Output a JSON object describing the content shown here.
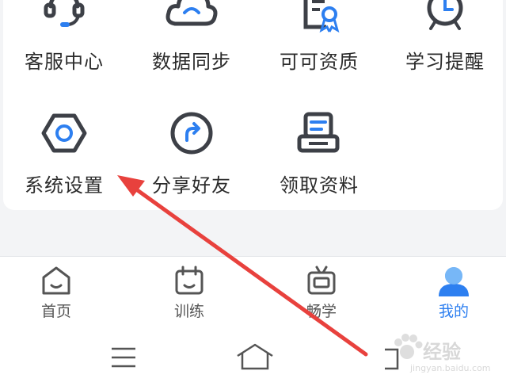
{
  "services": [
    {
      "label": "客服中心",
      "icon": "headset-icon"
    },
    {
      "label": "数据同步",
      "icon": "cloud-sync-icon"
    },
    {
      "label": "可可资质",
      "icon": "certificate-icon"
    },
    {
      "label": "学习提醒",
      "icon": "alarm-clock-icon"
    },
    {
      "label": "系统设置",
      "icon": "settings-hexagon-icon"
    },
    {
      "label": "分享好友",
      "icon": "share-arrow-icon"
    },
    {
      "label": "领取资料",
      "icon": "printer-icon"
    }
  ],
  "tabs": [
    {
      "label": "首页",
      "icon": "home-icon",
      "active": false
    },
    {
      "label": "训练",
      "icon": "training-icon",
      "active": false
    },
    {
      "label": "畅学",
      "icon": "tv-icon",
      "active": false
    },
    {
      "label": "我的",
      "icon": "profile-icon",
      "active": true
    }
  ],
  "system_nav": {
    "icons": [
      "menu-icon",
      "home-outline-icon",
      "back-icon"
    ]
  },
  "watermark": {
    "brand": "经验",
    "url": "jingyan.baidu.com"
  },
  "colors": {
    "accent": "#2d7ff0",
    "icon_dark": "#3d4047",
    "annotation_arrow": "#e8413d"
  }
}
